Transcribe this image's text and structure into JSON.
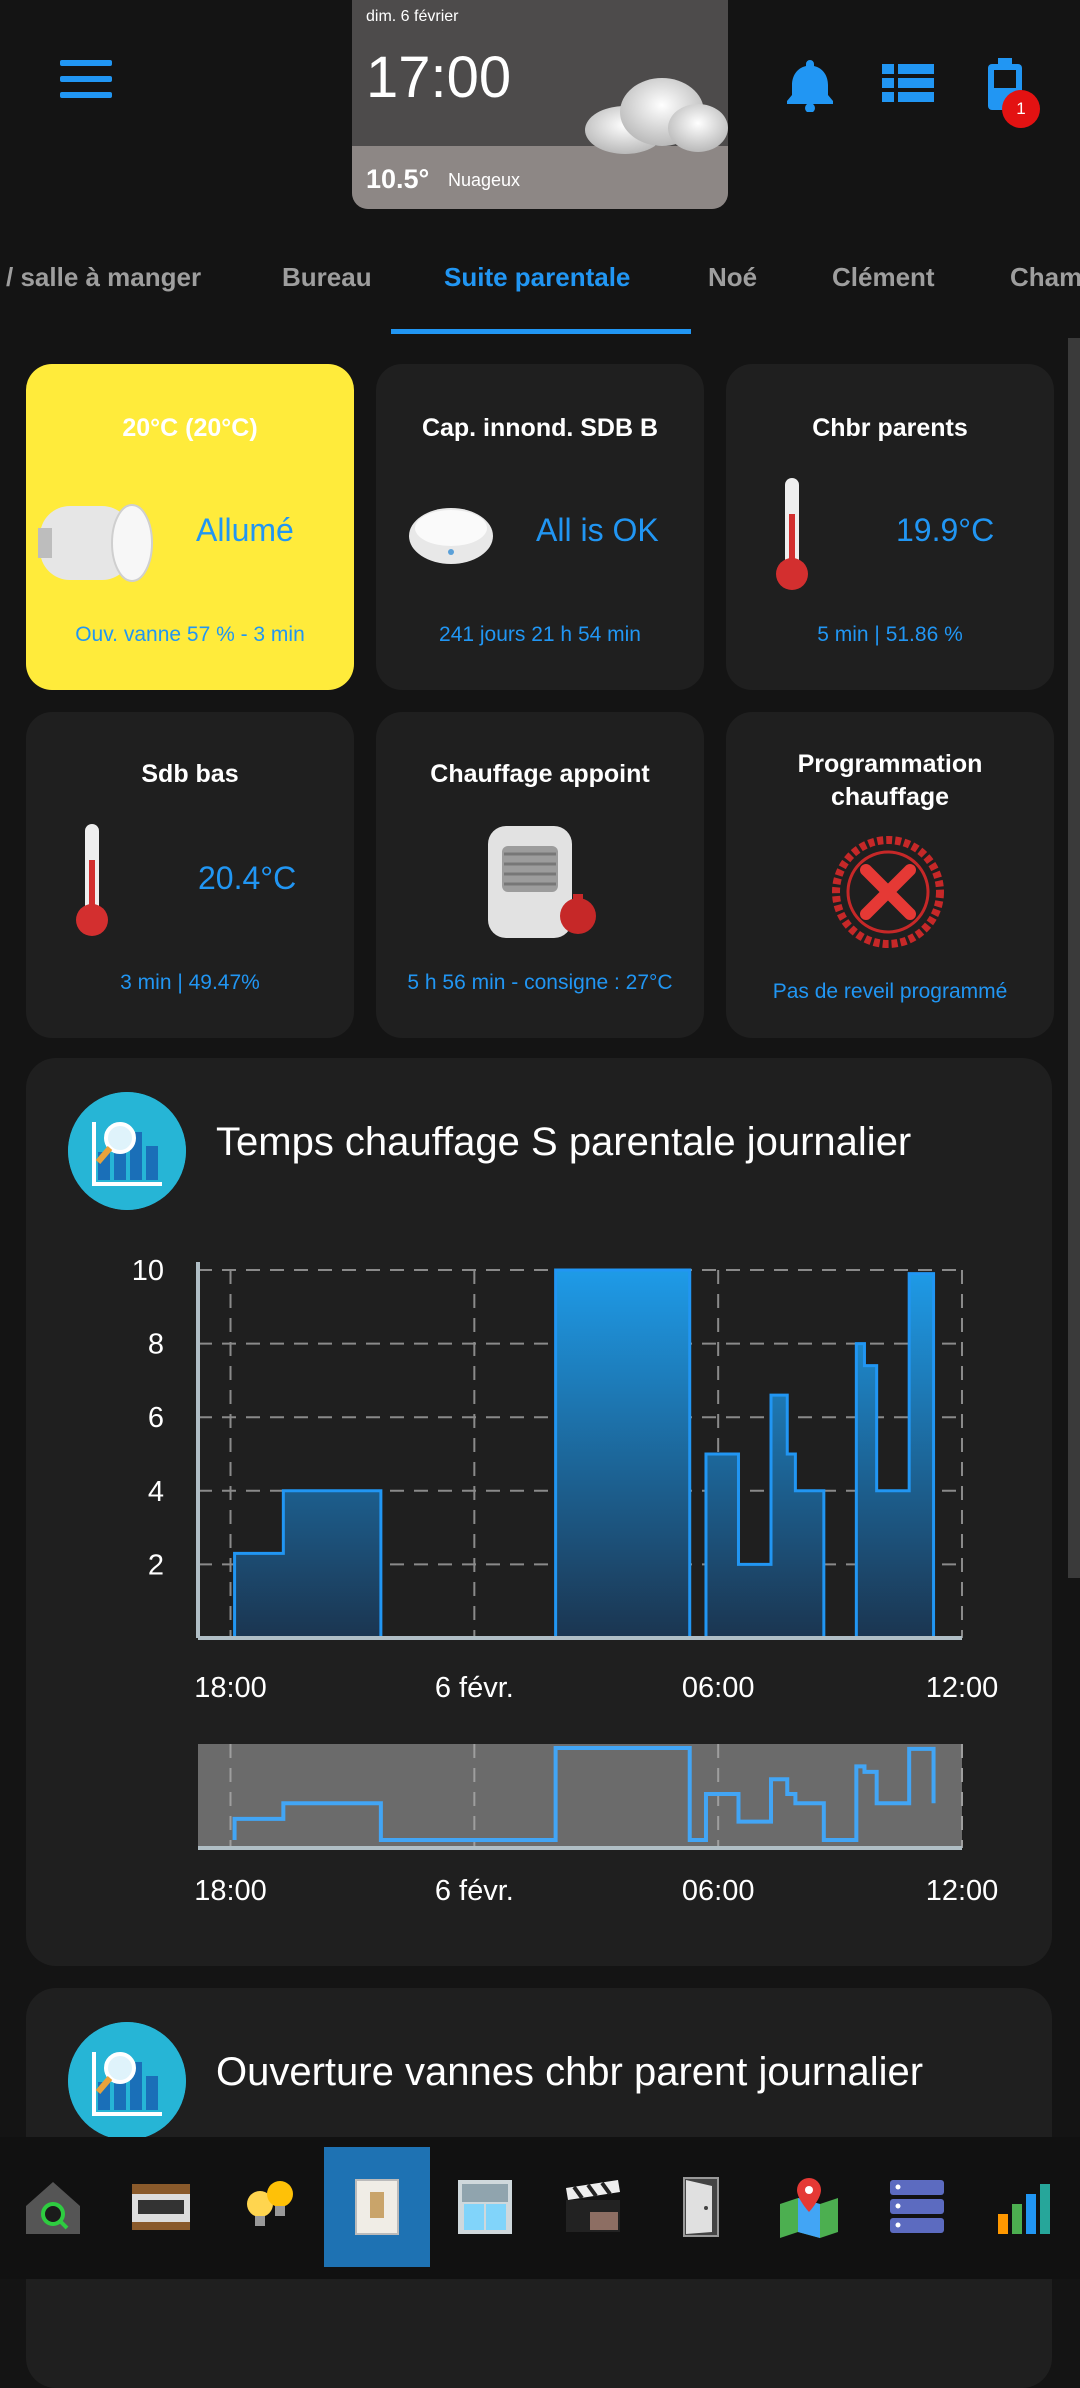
{
  "header": {
    "weather": {
      "date": "dim. 6 février",
      "time": "17:00",
      "temperature": "10.5°",
      "condition": "Nuageux"
    },
    "battery_badge": "1",
    "accent_color": "#2196f3"
  },
  "tabs": [
    {
      "label": "/ salle à manger"
    },
    {
      "label": "Bureau"
    },
    {
      "label": "Suite parentale"
    },
    {
      "label": "Noé"
    },
    {
      "label": "Clément"
    },
    {
      "label": "Cham"
    }
  ],
  "active_tab": "Suite parentale",
  "cards": [
    {
      "title": "20°C (20°C)",
      "value": "Allumé",
      "footer": "Ouv. vanne 57 % - 3 min",
      "icon": "thermostatic-valve-icon"
    },
    {
      "title": "Cap. innond. SDB B",
      "value": "All is OK",
      "footer": "241 jours 21 h 54 min",
      "icon": "flood-sensor-icon"
    },
    {
      "title": "Chbr parents",
      "value": "19.9°C",
      "footer": "5 min | 51.86 %",
      "icon": "thermometer-icon"
    },
    {
      "title": "Sdb bas",
      "value": "20.4°C",
      "footer": "3 min | 49.47%",
      "icon": "thermometer-icon"
    },
    {
      "title": "Chauffage appoint",
      "value": "",
      "footer": "5 h 56 min - consigne : 27°C",
      "icon": "heater-icon"
    },
    {
      "title": "Programmation chauffage",
      "value": "",
      "footer": "Pas de reveil programmé",
      "icon": "red-cross-icon"
    }
  ],
  "graph1": {
    "title": "Temps chauffage S parentale journalier"
  },
  "graph2": {
    "title": "Ouverture vannes chbr parent journalier"
  },
  "chart_data": {
    "type": "area",
    "title": "Temps chauffage S parentale journalier",
    "xlabel": "",
    "ylabel": "",
    "ylim": [
      0,
      10
    ],
    "yticks": [
      2,
      4,
      6,
      8,
      10
    ],
    "x_tick_labels": [
      "18:00",
      "6 févr.",
      "06:00",
      "12:00"
    ],
    "x_range_hours": [
      -0.8,
      18.0
    ],
    "grid": true,
    "step_points": [
      {
        "x": 0.1,
        "y": 0
      },
      {
        "x": 0.1,
        "y": 2.3
      },
      {
        "x": 1.3,
        "y": 2.3
      },
      {
        "x": 1.3,
        "y": 4
      },
      {
        "x": 3.7,
        "y": 4
      },
      {
        "x": 3.7,
        "y": 0
      },
      {
        "x": 8.0,
        "y": 0
      },
      {
        "x": 8.0,
        "y": 10
      },
      {
        "x": 11.3,
        "y": 10
      },
      {
        "x": 11.3,
        "y": 0
      },
      {
        "x": 11.7,
        "y": 0
      },
      {
        "x": 11.7,
        "y": 5
      },
      {
        "x": 12.5,
        "y": 5
      },
      {
        "x": 12.5,
        "y": 2
      },
      {
        "x": 13.3,
        "y": 2
      },
      {
        "x": 13.3,
        "y": 6.6
      },
      {
        "x": 13.7,
        "y": 6.6
      },
      {
        "x": 13.7,
        "y": 5
      },
      {
        "x": 13.9,
        "y": 5
      },
      {
        "x": 13.9,
        "y": 4
      },
      {
        "x": 14.6,
        "y": 4
      },
      {
        "x": 14.6,
        "y": 0
      },
      {
        "x": 15.4,
        "y": 0
      },
      {
        "x": 15.4,
        "y": 8
      },
      {
        "x": 15.6,
        "y": 8
      },
      {
        "x": 15.6,
        "y": 7.4
      },
      {
        "x": 15.9,
        "y": 7.4
      },
      {
        "x": 15.9,
        "y": 4
      },
      {
        "x": 16.7,
        "y": 4
      },
      {
        "x": 16.7,
        "y": 9.9
      },
      {
        "x": 17.3,
        "y": 9.9
      },
      {
        "x": 17.3,
        "y": 4
      }
    ]
  },
  "bottom_nav": [
    {
      "icon": "home-search-icon",
      "active": false
    },
    {
      "icon": "kitchen-icon",
      "active": false
    },
    {
      "icon": "light-bulbs-icon",
      "active": false
    },
    {
      "icon": "thermostat-icon",
      "active": true
    },
    {
      "icon": "window-shutter-icon",
      "active": false
    },
    {
      "icon": "clapperboard-icon",
      "active": false
    },
    {
      "icon": "door-icon",
      "active": false
    },
    {
      "icon": "map-pin-icon",
      "active": false
    },
    {
      "icon": "server-icon",
      "active": false
    },
    {
      "icon": "bar-chart-icon",
      "active": false
    }
  ]
}
